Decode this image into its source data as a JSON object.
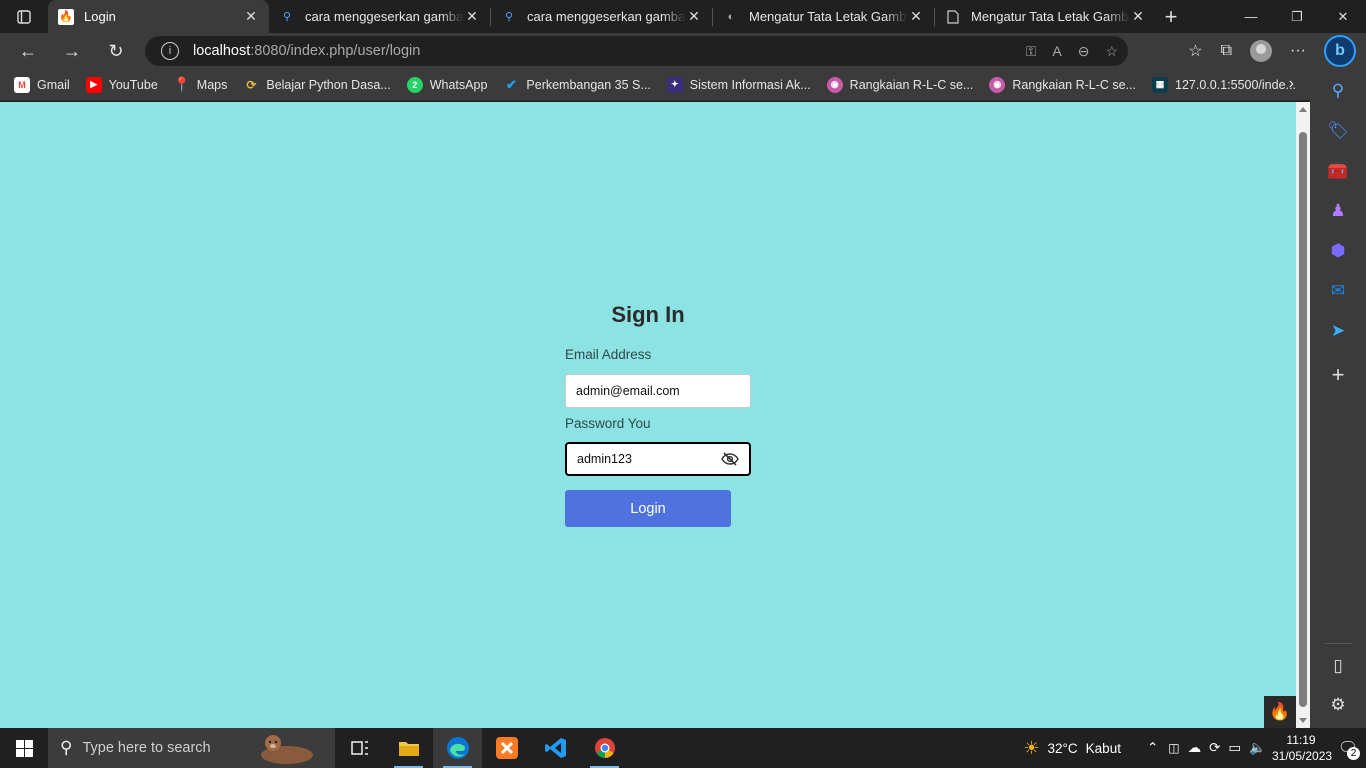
{
  "browser": {
    "tabs": [
      {
        "title": "Login",
        "active": true
      },
      {
        "title": "cara menggeserkan gambar di css",
        "active": false
      },
      {
        "title": "cara menggeserkan gambar di css",
        "active": false
      },
      {
        "title": "Mengatur Tata Letak Gambar",
        "active": false
      },
      {
        "title": "Mengatur Tata Letak Gambar",
        "active": false
      }
    ],
    "address": {
      "host": "localhost",
      "path": ":8080/index.php/user/login"
    },
    "bookmarks": [
      {
        "label": "Gmail",
        "icon": "gmail-icon",
        "color": "#ea4335"
      },
      {
        "label": "YouTube",
        "icon": "youtube-icon",
        "color": "#ff0000"
      },
      {
        "label": "Maps",
        "icon": "maps-icon",
        "color": "#34a853"
      },
      {
        "label": "Belajar Python Dasa...",
        "icon": "python-icon",
        "color": "#3776ab"
      },
      {
        "label": "WhatsApp",
        "icon": "whatsapp-icon",
        "color": "#25d366"
      },
      {
        "label": "Perkembangan 35 S...",
        "icon": "check-icon",
        "color": "#1da1f2"
      },
      {
        "label": "Sistem Informasi Ak...",
        "icon": "university-icon",
        "color": "#3b2d7a"
      },
      {
        "label": "Rangkaian R-L-C se...",
        "icon": "site-icon",
        "color": "#c45ca8"
      },
      {
        "label": "Rangkaian R-L-C se...",
        "icon": "site-icon",
        "color": "#c45ca8"
      },
      {
        "label": "127.0.0.1:5500/inde...",
        "icon": "local-icon",
        "color": "#0b3d4d"
      }
    ]
  },
  "login": {
    "title": "Sign In",
    "email_label": "Email Address",
    "email_value": "admin@email.com",
    "password_label": "Password You",
    "password_value": "admin123",
    "button_label": "Login"
  },
  "taskbar": {
    "search_placeholder": "Type here to search",
    "weather": {
      "temp": "32°C",
      "condition": "Kabut"
    },
    "time": "11:19",
    "date": "31/05/2023",
    "notifications": "2"
  },
  "colors": {
    "page_bg": "#8de3e3",
    "button": "#4e73df"
  }
}
